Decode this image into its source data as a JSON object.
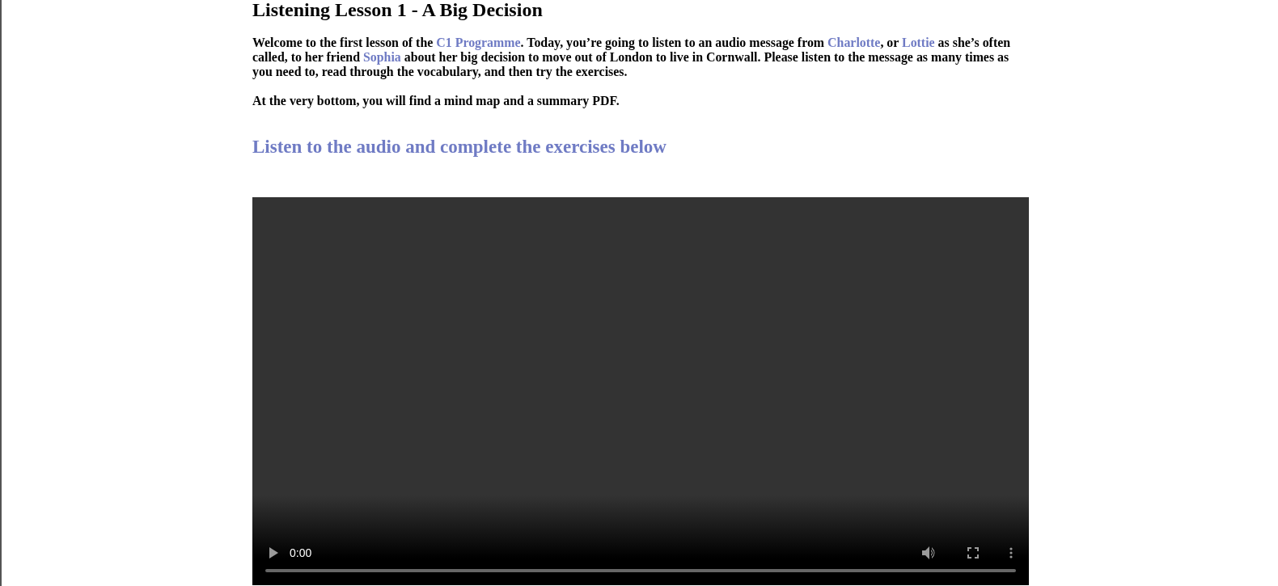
{
  "lesson": {
    "title": "Listening Lesson 1 - A Big Decision",
    "intro": [
      {
        "kind": "text",
        "text": "Welcome to the first lesson of the "
      },
      {
        "kind": "link",
        "text": "C1 Programme"
      },
      {
        "kind": "text",
        "text": ". Today, you’re going to listen to an audio message from "
      },
      {
        "kind": "link",
        "text": "Charlotte"
      },
      {
        "kind": "text",
        "text": ", or "
      },
      {
        "kind": "link",
        "text": "Lottie"
      },
      {
        "kind": "text",
        "text": " as she’s often called, to her friend "
      },
      {
        "kind": "link",
        "text": "Sophia"
      },
      {
        "kind": "text",
        "text": " about her big decision to move out of London to live in Cornwall. Please listen to the message as many times as you need to, read through the vocabulary, and then try the exercises."
      }
    ],
    "note": "At the very bottom, you will find a mind map and a summary PDF.",
    "subheading": "Listen to the audio and complete the exercises below"
  },
  "video": {
    "time": "0:00",
    "progress": {
      "level": 0
    }
  }
}
